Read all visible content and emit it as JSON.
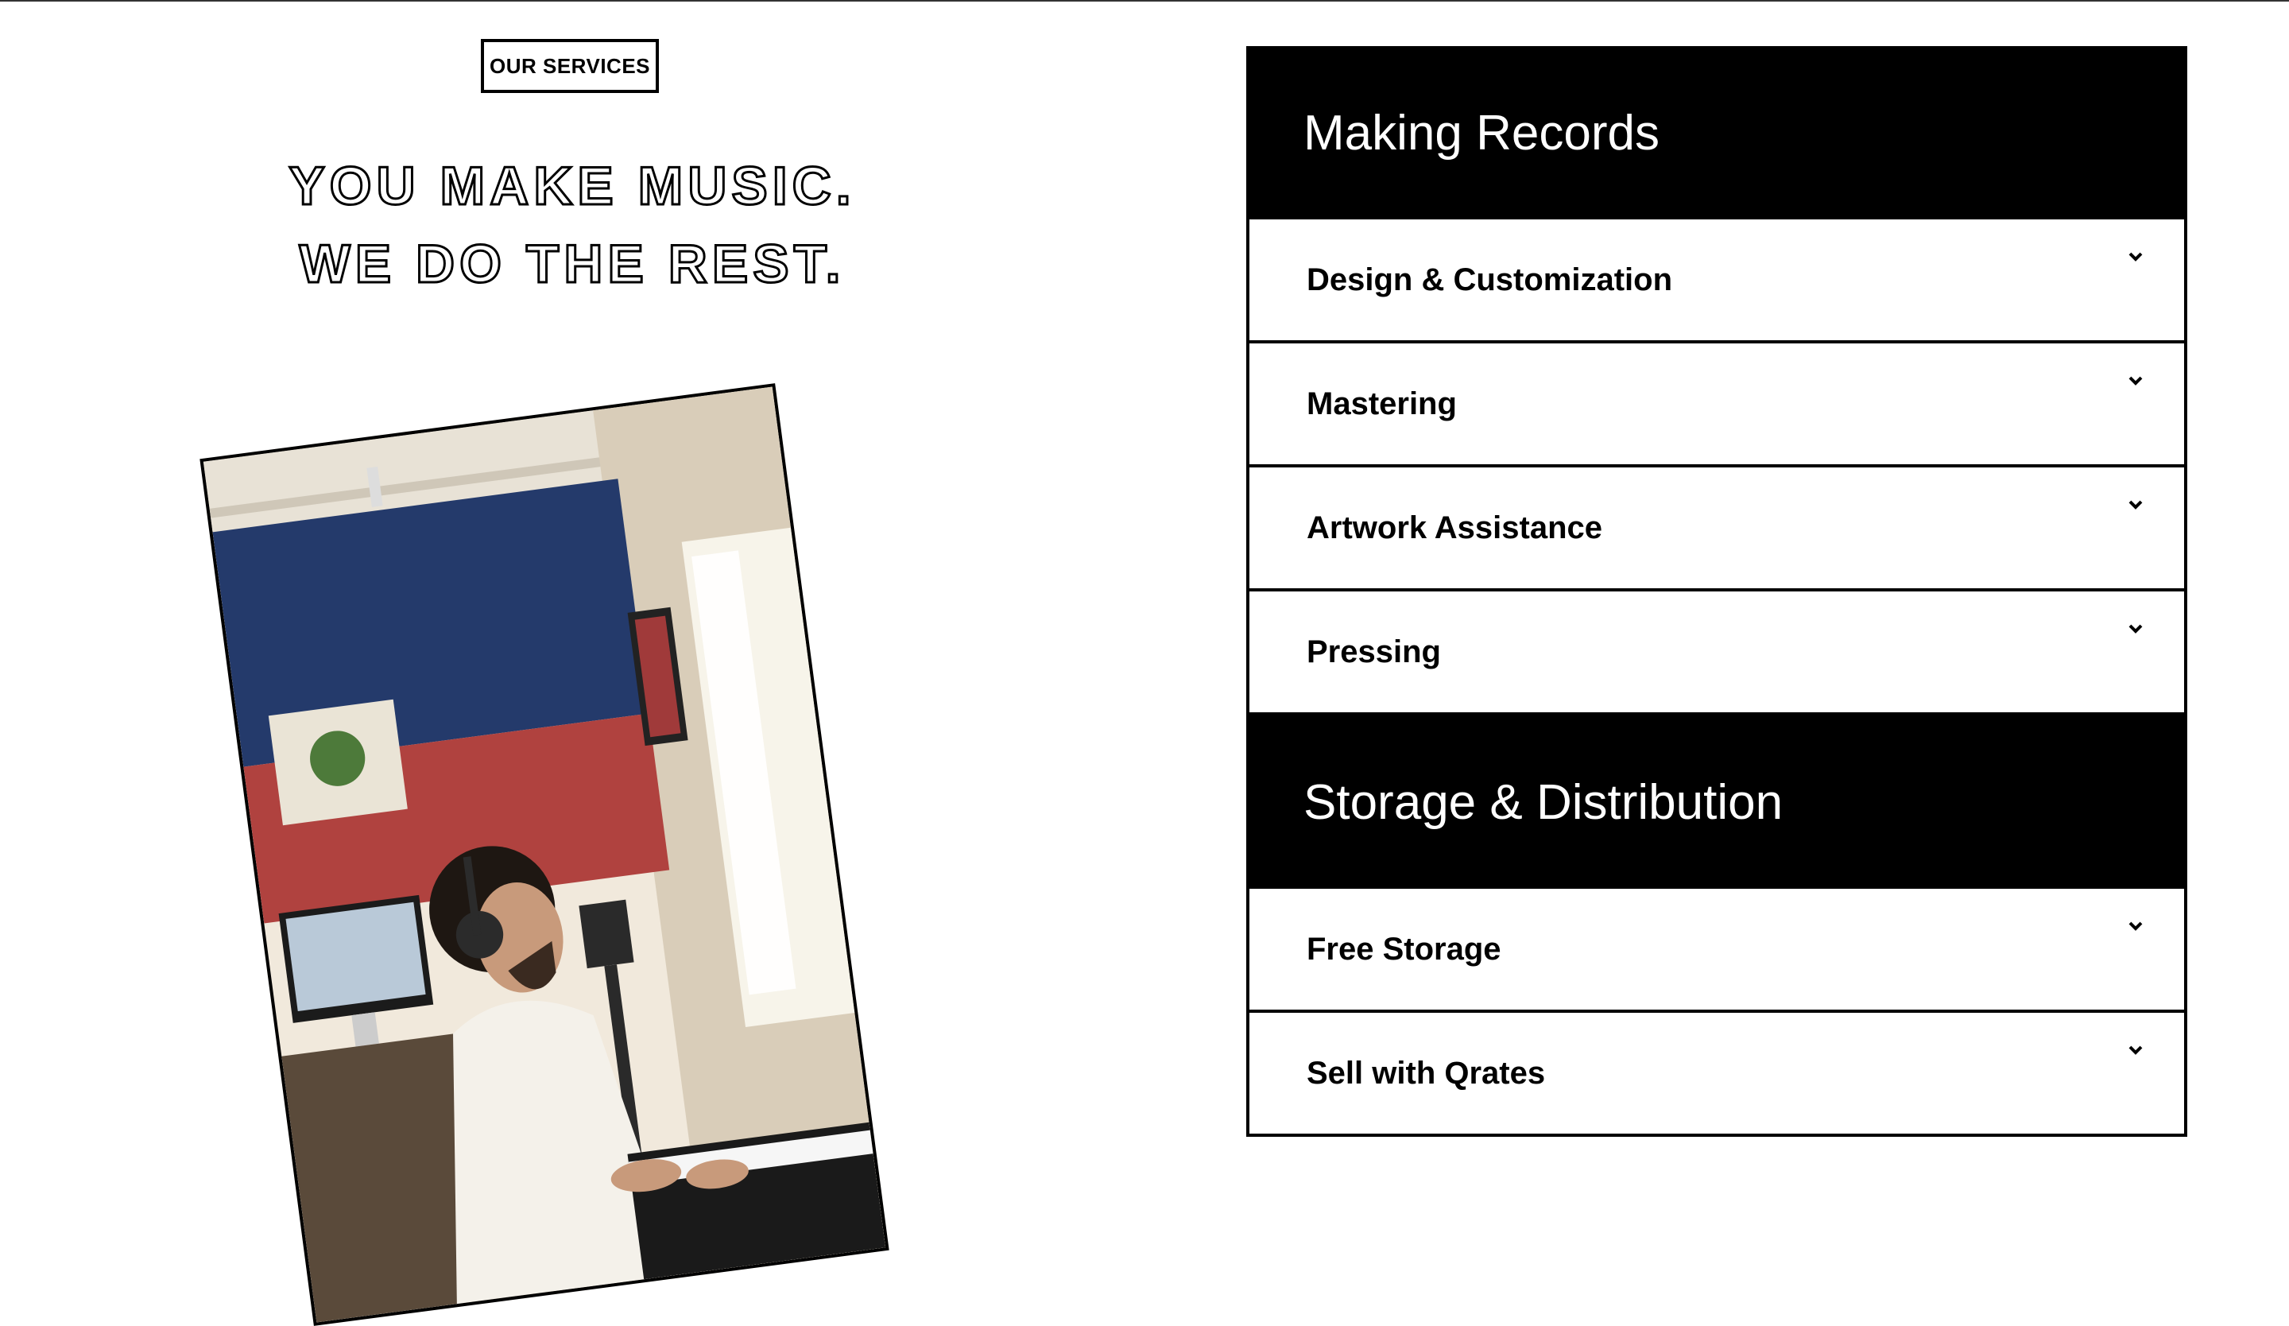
{
  "left": {
    "badge": "OUR SERVICES",
    "headline_lines": [
      "YOU MAKE MUSIC.",
      "WE DO THE REST."
    ],
    "photo_icon": "studio-musician-photo"
  },
  "sections": [
    {
      "title": "Making Records",
      "items": [
        {
          "label": "Design & Customization"
        },
        {
          "label": "Mastering"
        },
        {
          "label": "Artwork Assistance"
        },
        {
          "label": "Pressing"
        }
      ]
    },
    {
      "title": "Storage & Distribution",
      "items": [
        {
          "label": "Free Storage"
        },
        {
          "label": "Sell with Qrates"
        }
      ]
    }
  ],
  "colors": {
    "accent": "#000000",
    "background": "#ffffff"
  }
}
